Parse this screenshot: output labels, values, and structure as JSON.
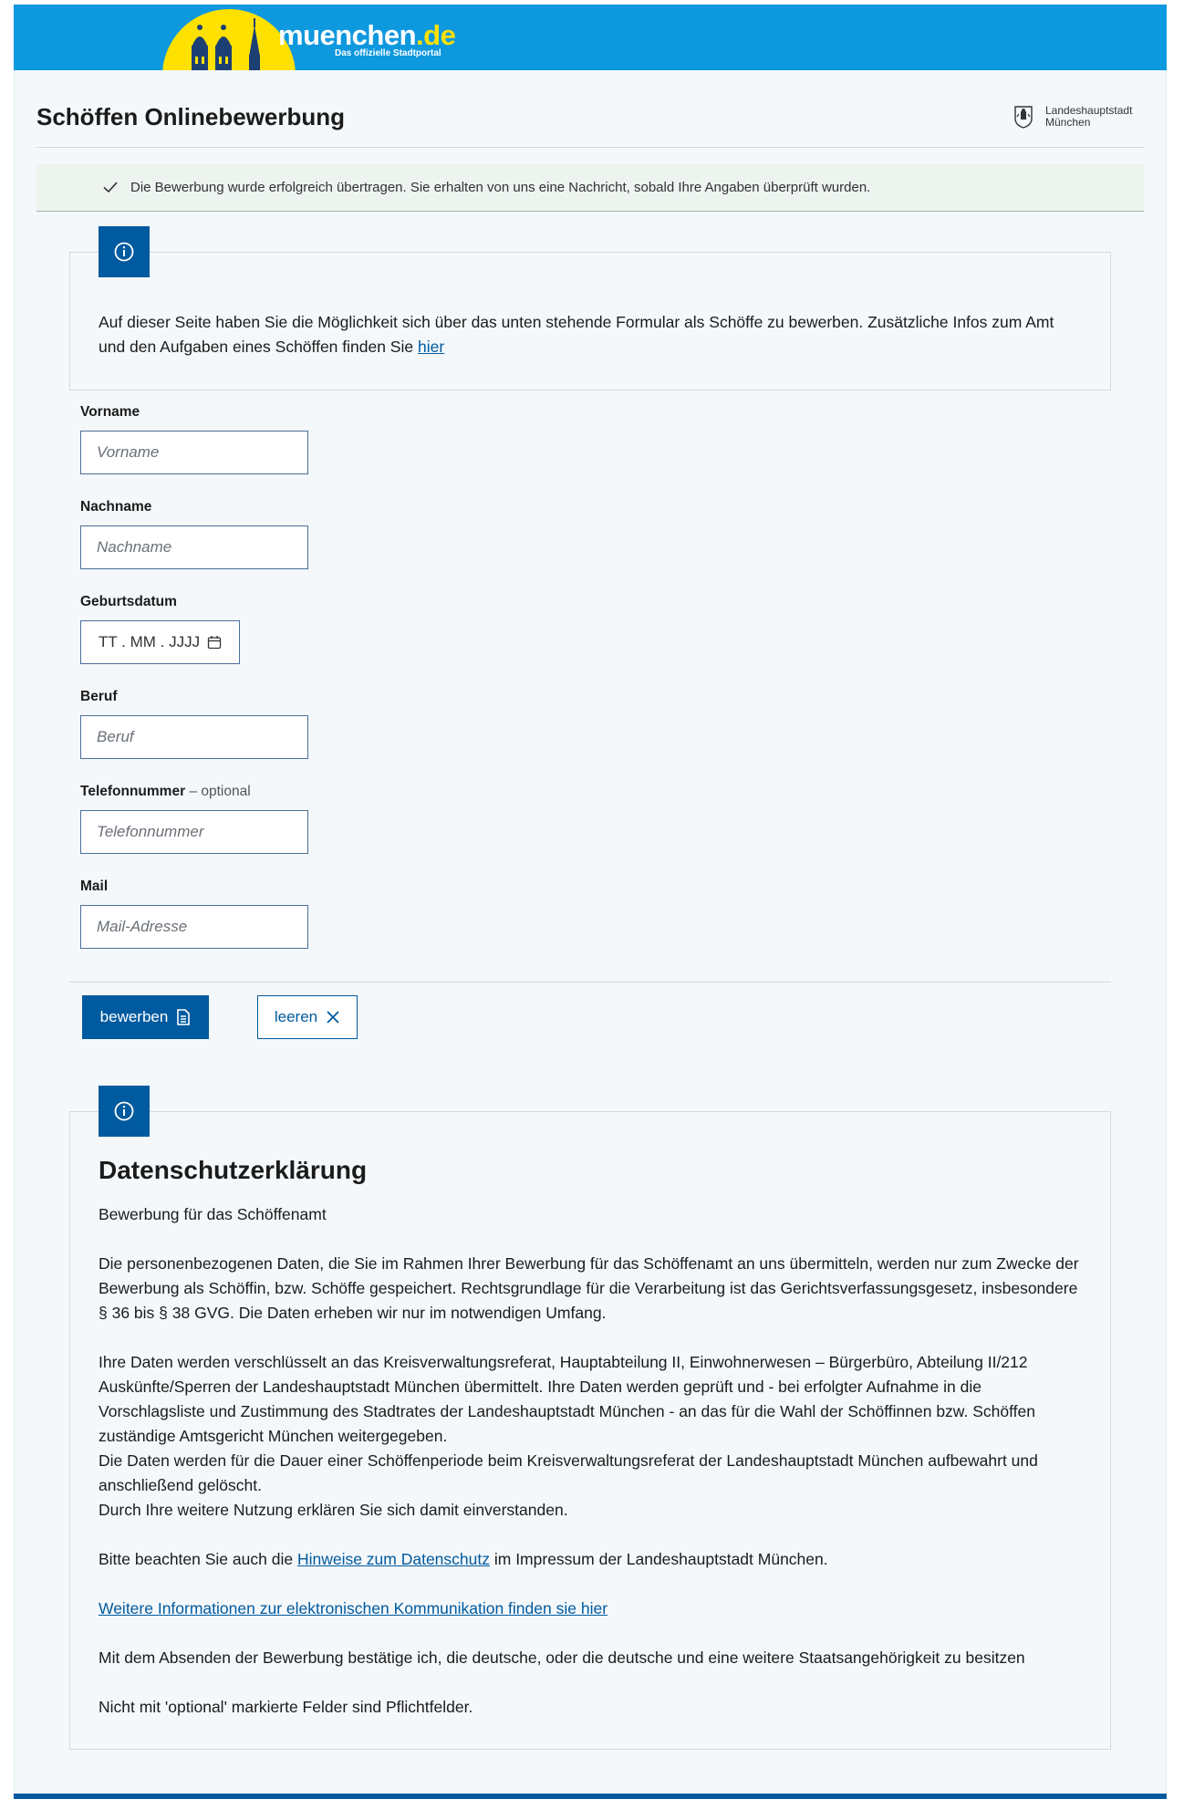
{
  "header": {
    "logo_text": "muenchen",
    "logo_tld": ".de",
    "logo_subtitle": "Das offizielle Stadtportal"
  },
  "page": {
    "title": "Schöffen Onlinebewerbung",
    "city_line1": "Landeshauptstadt",
    "city_line2": "München"
  },
  "success": {
    "message": "Die Bewerbung wurde erfolgreich übertragen. Sie erhalten von uns eine Nachricht, sobald Ihre Angaben überprüft wurden."
  },
  "intro": {
    "text_before": "Auf dieser Seite haben Sie die Möglichkeit sich über das unten stehende Formular als Schöffe zu bewerben. Zusätzliche Infos zum Amt und den Aufgaben eines Schöffen finden Sie ",
    "link": "hier"
  },
  "form": {
    "vorname": {
      "label": "Vorname",
      "placeholder": "Vorname",
      "value": ""
    },
    "nachname": {
      "label": "Nachname",
      "placeholder": "Nachname",
      "value": ""
    },
    "geburtsdatum": {
      "label": "Geburtsdatum",
      "placeholder": "TT . MM . JJJJ"
    },
    "beruf": {
      "label": "Beruf",
      "placeholder": "Beruf",
      "value": ""
    },
    "telefon": {
      "label": "Telefonnummer",
      "optional": "– optional",
      "placeholder": "Telefonnummer",
      "value": ""
    },
    "mail": {
      "label": "Mail",
      "placeholder": "Mail-Adresse",
      "value": ""
    }
  },
  "buttons": {
    "submit": "bewerben",
    "clear": "leeren"
  },
  "privacy": {
    "title": "Datenschutzerklärung",
    "subtitle": "Bewerbung für das Schöffenamt",
    "p1": "Die personenbezogenen Daten, die Sie im Rahmen Ihrer Bewerbung für das Schöffenamt an uns übermitteln, werden nur zum Zwecke der Bewerbung als Schöffin, bzw. Schöffe gespeichert. Rechtsgrundlage für die Verarbeitung ist das Gerichtsverfassungsgesetz, insbesondere § 36 bis § 38 GVG. Die Daten erheben wir nur im notwendigen Umfang.",
    "p2": "Ihre Daten werden verschlüsselt an das Kreisverwaltungsreferat, Hauptabteilung II, Einwohnerwesen – Bürgerbüro, Abteilung II/212 Auskünfte/Sperren der Landeshauptstadt München übermittelt. Ihre Daten werden geprüft und - bei erfolgter Aufnahme in die Vorschlagsliste und Zustimmung des Stadtrates der Landeshauptstadt München - an das für die Wahl der Schöffinnen bzw. Schöffen zuständige Amtsgericht München weitergegeben.",
    "p3": "Die Daten werden für die Dauer einer Schöffenperiode beim Kreisverwaltungsreferat der Landeshauptstadt München aufbewahrt und anschließend gelöscht.",
    "p4": "Durch Ihre weitere Nutzung erklären Sie sich damit einverstanden.",
    "p5_before": "Bitte beachten Sie auch die ",
    "p5_link": "Hinweise zum Datenschutz",
    "p5_after": " im Impressum der Landeshauptstadt München.",
    "p6_link": "Weitere Informationen zur elektronischen Kommunikation finden sie hier",
    "p7": "Mit dem Absenden der Bewerbung bestätige ich, die deutsche, oder die deutsche und eine weitere Staatsangehörigkeit zu besitzen",
    "p8": "Nicht mit 'optional' markierte Felder sind Pflichtfelder."
  },
  "colors": {
    "header_blue": "#0e98de",
    "brand_yellow": "#ffe100",
    "primary": "#005a9f"
  },
  "icons": [
    "frauenkirche-icon",
    "info-icon",
    "check-icon",
    "calendar-icon",
    "document-icon",
    "close-icon",
    "city-crest-icon"
  ]
}
